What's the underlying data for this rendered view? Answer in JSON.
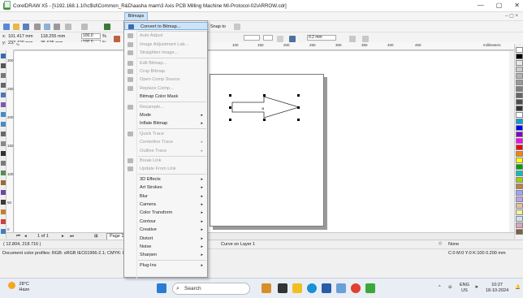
{
  "window": {
    "title": "CorelDRAW X5 - [\\\\192.168.1.10\\c$\\d\\Common_R&D\\aasha mam\\3 Axis PCB Milling Machine MI-Protocol-02\\ARROW.cdr]",
    "minimize": "—",
    "maximize": "▢",
    "close": "✕",
    "doc_controls": "– ▢ ×"
  },
  "menubar": {
    "bitmaps_label": "Bitmaps"
  },
  "properties": {
    "x_label": "x:",
    "x_value": "101.417 mm",
    "y_label": "y:",
    "y_value": "233.429 mm",
    "w_value": "118.255 mm",
    "h_value": "35.635 mm",
    "scale_w": "100.0",
    "scale_h": "100.0",
    "pct": "%",
    "snap_to": "Snap to",
    "outline_width": "0.2 mm",
    "units": "millimeters"
  },
  "hruler_ticks": [
    "50",
    "100",
    "150",
    "200",
    "250",
    "300",
    "350",
    "400",
    "450",
    "500"
  ],
  "vruler_ticks": [
    "300",
    "250",
    "200",
    "150",
    "100",
    "50",
    "0"
  ],
  "page_nav": {
    "counter": "1 of 1",
    "page_tab": "Page 1"
  },
  "status": {
    "coords": "( 12.804, 218.716 )",
    "profiles": "Document color profiles: RGB: sRGB IEC61966-2.1; CMYK: ISO Co",
    "object": "Curve on Layer 1",
    "fill": "None",
    "outline": "C:0 M:0 Y:0 K:100  0.200 mm"
  },
  "taskbar": {
    "temp": "28°C",
    "weather": "Haze",
    "search": "Search",
    "lang1": "ENG",
    "lang2": "US",
    "time": "10:27",
    "date": "18-10-2024"
  },
  "bitmaps_menu": {
    "items": [
      {
        "label": "Convert to Bitmap...",
        "state": "highlighted",
        "has_submenu": false,
        "icon": "convert-bitmap-icon"
      },
      {
        "label": "Auto Adjust",
        "state": "disabled",
        "has_submenu": false,
        "icon": "auto-adjust-icon"
      },
      {
        "label": "Image Adjustment Lab...",
        "state": "disabled",
        "has_submenu": false,
        "icon": "image-lab-icon"
      },
      {
        "label": "Straighten Image...",
        "state": "disabled",
        "has_submenu": false,
        "icon": "straighten-icon"
      },
      {
        "label": "Edit Bitmap...",
        "state": "disabled",
        "has_submenu": false,
        "icon": "edit-bitmap-icon"
      },
      {
        "label": "Crop Bitmap",
        "state": "disabled",
        "has_submenu": false,
        "icon": "crop-icon"
      },
      {
        "label": "Open Comp Source",
        "state": "disabled",
        "has_submenu": false,
        "icon": "comp-source-icon"
      },
      {
        "label": "Replace Comp...",
        "state": "disabled",
        "has_submenu": false,
        "icon": "replace-comp-icon"
      },
      {
        "label": "Bitmap Color Mask",
        "state": "enabled",
        "has_submenu": false,
        "icon": ""
      },
      {
        "label": "Resample...",
        "state": "disabled",
        "has_submenu": false,
        "icon": "resample-icon"
      },
      {
        "label": "Mode",
        "state": "enabled",
        "has_submenu": true,
        "icon": ""
      },
      {
        "label": "Inflate Bitmap",
        "state": "enabled",
        "has_submenu": true,
        "icon": ""
      },
      {
        "label": "Quick Trace",
        "state": "disabled",
        "has_submenu": false,
        "icon": "quick-trace-icon"
      },
      {
        "label": "Centerline Trace",
        "state": "disabled",
        "has_submenu": true,
        "icon": ""
      },
      {
        "label": "Outline Trace",
        "state": "disabled",
        "has_submenu": true,
        "icon": ""
      },
      {
        "label": "Break Link",
        "state": "disabled",
        "has_submenu": false,
        "icon": "break-link-icon"
      },
      {
        "label": "Update From Link",
        "state": "disabled",
        "has_submenu": false,
        "icon": "update-link-icon"
      },
      {
        "label": "3D Effects",
        "state": "enabled",
        "has_submenu": true,
        "icon": ""
      },
      {
        "label": "Art Strokes",
        "state": "enabled",
        "has_submenu": true,
        "icon": ""
      },
      {
        "label": "Blur",
        "state": "enabled",
        "has_submenu": true,
        "icon": ""
      },
      {
        "label": "Camera",
        "state": "enabled",
        "has_submenu": true,
        "icon": ""
      },
      {
        "label": "Color Transform",
        "state": "enabled",
        "has_submenu": true,
        "icon": ""
      },
      {
        "label": "Contour",
        "state": "enabled",
        "has_submenu": true,
        "icon": ""
      },
      {
        "label": "Creative",
        "state": "enabled",
        "has_submenu": true,
        "icon": ""
      },
      {
        "label": "Distort",
        "state": "enabled",
        "has_submenu": true,
        "icon": ""
      },
      {
        "label": "Noise",
        "state": "enabled",
        "has_submenu": true,
        "icon": ""
      },
      {
        "label": "Sharpen",
        "state": "enabled",
        "has_submenu": true,
        "icon": ""
      },
      {
        "label": "Plug-Ins",
        "state": "enabled",
        "has_submenu": true,
        "icon": ""
      }
    ],
    "separators_after": [
      0,
      3,
      8,
      11,
      14,
      16,
      26
    ]
  },
  "palette_colors": [
    "#ffffff",
    "#000000",
    "#e6e6e6",
    "#cccccc",
    "#b3b3b3",
    "#999999",
    "#808080",
    "#666666",
    "#4d4d4d",
    "#333333",
    "#ffffff",
    "#00a0e0",
    "#0000ff",
    "#8000c0",
    "#ff00ff",
    "#ff0000",
    "#ff8000",
    "#ffff00",
    "#00a000",
    "#00c0c0",
    "#a0d000",
    "#c08040",
    "#a0a0ff",
    "#c0a0e0",
    "#e0c0a0",
    "#f0f0a0",
    "#d0e0f0",
    "#e0a0c0",
    "#806040"
  ],
  "colors": {
    "highlight": "#cfe3f6",
    "accent": "#0078d7"
  }
}
